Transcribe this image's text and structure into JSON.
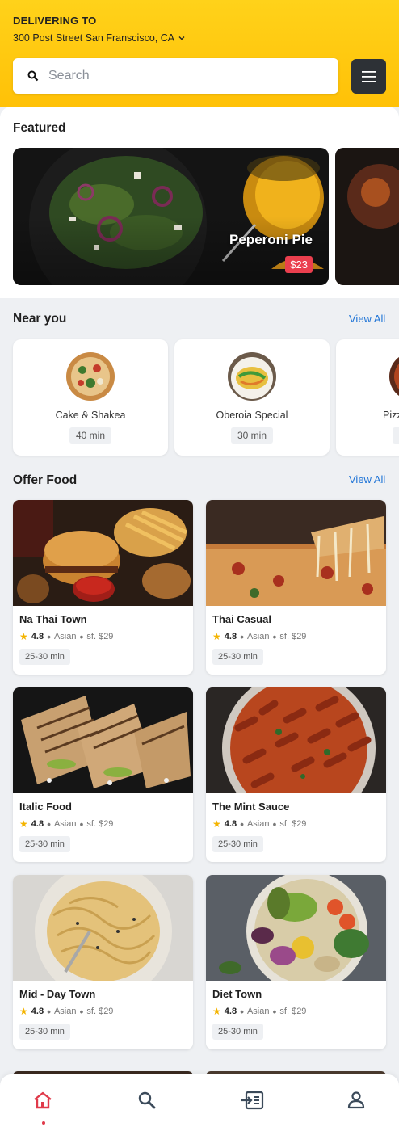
{
  "header": {
    "delivering_label": "DELIVERING TO",
    "address": "300 Post Street San Franscisco, CA",
    "search_placeholder": "Search"
  },
  "featured": {
    "title": "Featured",
    "cards": [
      {
        "name": "Peperoni Pie",
        "price": "$23"
      }
    ]
  },
  "near_you": {
    "title": "Near you",
    "view_all": "View All",
    "items": [
      {
        "name": "Cake & Shakea",
        "time": "40 min"
      },
      {
        "name": "Oberoia Special",
        "time": "30 min"
      },
      {
        "name": "Pizza",
        "time": ""
      }
    ]
  },
  "offer_food": {
    "title": "Offer Food",
    "view_all": "View All",
    "items": [
      {
        "name": "Na Thai Town",
        "rating": "4.8",
        "cuisine": "Asian",
        "price": "sf. $29",
        "time": "25-30 min"
      },
      {
        "name": "Thai Casual",
        "rating": "4.8",
        "cuisine": "Asian",
        "price": "sf. $29",
        "time": "25-30 min"
      },
      {
        "name": "Italic Food",
        "rating": "4.8",
        "cuisine": "Asian",
        "price": "sf. $29",
        "time": "25-30 min"
      },
      {
        "name": "The Mint Sauce",
        "rating": "4.8",
        "cuisine": "Asian",
        "price": "sf. $29",
        "time": "25-30 min"
      },
      {
        "name": "Mid - Day Town",
        "rating": "4.8",
        "cuisine": "Asian",
        "price": "sf. $29",
        "time": "25-30 min"
      },
      {
        "name": "Diet Town",
        "rating": "4.8",
        "cuisine": "Asian",
        "price": "sf. $29",
        "time": "25-30 min"
      }
    ]
  },
  "bottom_nav": {
    "items": [
      {
        "icon": "home-icon",
        "active": true
      },
      {
        "icon": "search-icon",
        "active": false
      },
      {
        "icon": "orders-icon",
        "active": false
      },
      {
        "icon": "profile-icon",
        "active": false
      }
    ]
  },
  "colors": {
    "header_yellow": "#ffc107",
    "accent_red": "#e03a4a",
    "link_blue": "#1e73d6",
    "dark_button": "#2d3136"
  }
}
